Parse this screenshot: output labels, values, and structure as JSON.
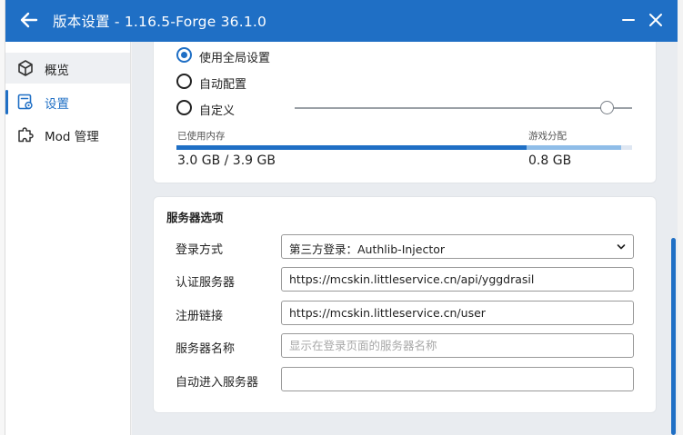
{
  "window": {
    "title": "版本设置 - 1.16.5-Forge 36.1.0"
  },
  "sidebar": {
    "items": [
      {
        "label": "概览",
        "icon": "cube-icon"
      },
      {
        "label": "设置",
        "icon": "settings-page-icon"
      },
      {
        "label": "Mod 管理",
        "icon": "puzzle-icon"
      }
    ]
  },
  "memory": {
    "options": [
      "使用全局设置",
      "自动配置",
      "自定义"
    ],
    "selected": "使用全局设置",
    "slider_value_fraction": 0.93,
    "used_label": "已使用内存",
    "game_label": "游戏分配",
    "used_value": "3.0 GB / 3.9 GB",
    "game_value": "0.8 GB"
  },
  "server": {
    "title": "服务器选项",
    "login_label": "登录方式",
    "login_value": "第三方登录：Authlib-Injector",
    "auth_label": "认证服务器",
    "auth_value": "https://mcskin.littleservice.cn/api/yggdrasil",
    "register_label": "注册链接",
    "register_value": "https://mcskin.littleservice.cn/user",
    "name_label": "服务器名称",
    "name_placeholder": "显示在登录页面的服务器名称",
    "autojoin_label": "自动进入服务器",
    "autojoin_value": ""
  },
  "colors": {
    "accent": "#1f6fc5",
    "game_bar": "#8fbde8"
  }
}
